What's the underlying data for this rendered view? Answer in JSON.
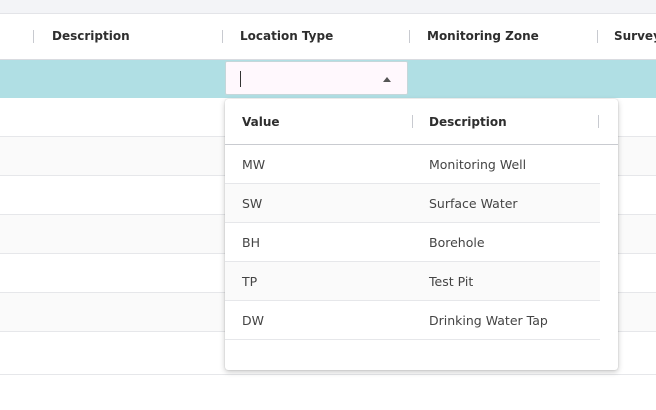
{
  "grid": {
    "columns": [
      {
        "label": "Description"
      },
      {
        "label": "Location Type"
      },
      {
        "label": "Monitoring Zone"
      },
      {
        "label": "Survey"
      }
    ]
  },
  "editor": {
    "location_type_value": ""
  },
  "dropdown": {
    "columns": {
      "value": "Value",
      "description": "Description"
    },
    "options": [
      {
        "value": "MW",
        "description": "Monitoring Well"
      },
      {
        "value": "SW",
        "description": "Surface Water"
      },
      {
        "value": "BH",
        "description": "Borehole"
      },
      {
        "value": "TP",
        "description": "Test Pit"
      },
      {
        "value": "DW",
        "description": "Drinking Water Tap"
      }
    ]
  },
  "colors": {
    "edit_row_bg": "#b0dfe4",
    "combo_bg": "#fff8fd"
  }
}
